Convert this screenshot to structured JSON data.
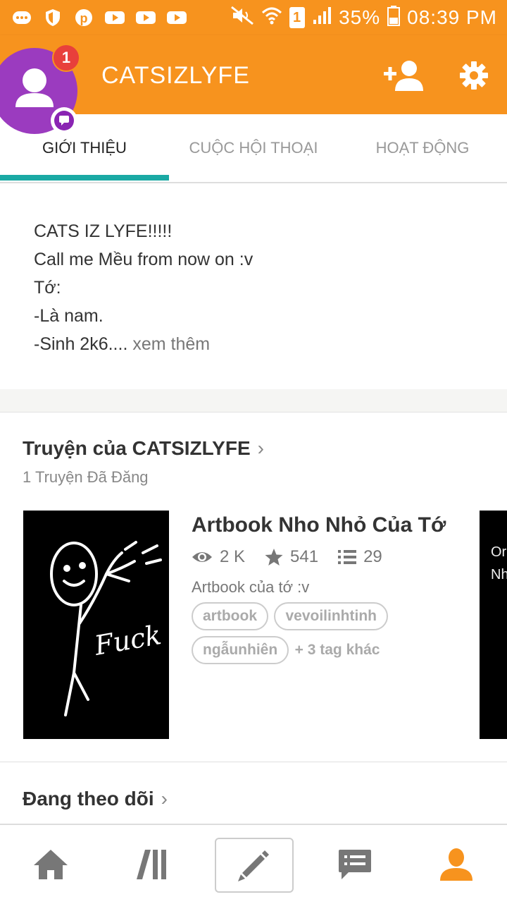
{
  "status_bar": {
    "battery": "35%",
    "time": "08:39 PM",
    "sim": "1"
  },
  "header": {
    "title": "CATSIZLYFE",
    "notification_count": "1"
  },
  "tabs": [
    {
      "label": "GIỚI THIỆU",
      "active": true
    },
    {
      "label": "CUỘC HỘI THOẠI",
      "active": false
    },
    {
      "label": "HOẠT ĐỘNG",
      "active": false
    }
  ],
  "bio": {
    "lines": [
      "CATS IZ LYFE!!!!!",
      "Call me Mều from now on :v",
      "Tớ:",
      "-Là nam."
    ],
    "last_line": "-Sinh 2k6....",
    "more_link": "xem thêm"
  },
  "stories_section": {
    "title": "Truyện của CATSIZLYFE",
    "subtitle": "1 Truyện Đã Đăng",
    "story": {
      "title": "Artbook Nho Nhỏ Của Tớ",
      "views": "2 K",
      "votes": "541",
      "parts": "29",
      "description": "Artbook của tớ :v",
      "tags": [
        "artbook",
        "vevoilinhtinh",
        "ngẫunhiên"
      ],
      "more_tags": "+ 3 tag khác",
      "cover_text": "Fuck"
    },
    "next_cover_text": [
      "Or",
      "Nh"
    ]
  },
  "following_section": {
    "title": "Đang theo dõi"
  },
  "colors": {
    "brand_orange": "#f7931e",
    "tab_indicator": "#1aa9a4",
    "avatar_purple": "#9b3bbf",
    "badge_red": "#e8403b"
  },
  "bottom_nav": [
    "home-icon",
    "library-icon",
    "pencil-icon",
    "messages-icon",
    "profile-icon"
  ]
}
